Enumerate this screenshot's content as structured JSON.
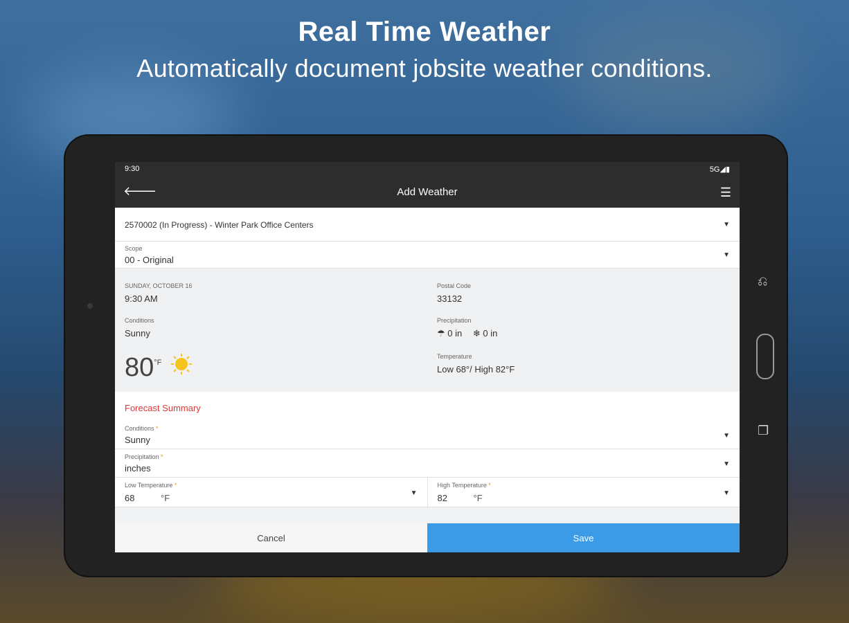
{
  "headline": {
    "title": "Real Time Weather",
    "subtitle": "Automatically document jobsite weather conditions."
  },
  "status_bar": {
    "time": "9:30",
    "signal": "5G◢▮"
  },
  "app_bar": {
    "back_icon": "arrow-left-icon",
    "title": "Add Weather",
    "menu_icon": "hamburger-menu-icon"
  },
  "project": {
    "value": "2570002 (In Progress) - Winter Park Office Centers"
  },
  "scope": {
    "label": "Scope",
    "value": "00 - Original"
  },
  "current": {
    "date_label": "SUNDAY, OCTOBER 16",
    "time": "9:30 AM",
    "postal_label": "Postal Code",
    "postal_value": "33132",
    "conditions_label": "Conditions",
    "conditions_value": "Sunny",
    "precip_label": "Precipitation",
    "rain_value": "0 in",
    "snow_value": "0 in",
    "temperature_big": "80",
    "temperature_unit": "°F",
    "temperature_label": "Temperature",
    "temperature_range": "Low 68°/ High 82°F"
  },
  "forecast": {
    "title": "Forecast Summary",
    "conditions_label": "Conditions",
    "conditions_value": "Sunny",
    "precip_label": "Precipitation",
    "precip_value": "inches",
    "low_label": "Low Temperature",
    "low_value": "68",
    "low_unit": "°F",
    "high_label": "High Temperature",
    "high_value": "82",
    "high_unit": "°F",
    "required_mark": "*"
  },
  "actions": {
    "cancel": "Cancel",
    "save": "Save"
  },
  "colors": {
    "accent_blue": "#3b9be6",
    "forecast_red": "#d93a3a",
    "appbar": "#2d2d2d"
  }
}
